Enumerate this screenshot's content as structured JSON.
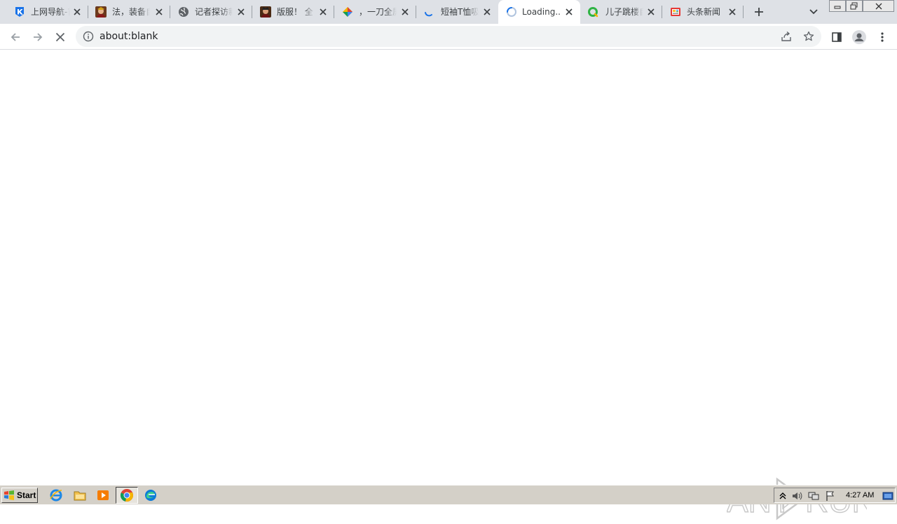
{
  "browser": {
    "tabs": [
      {
        "title": "上网导航-首",
        "icon": "navigation-site-icon",
        "active": false
      },
      {
        "title": "法，装备自",
        "icon": "game-avatar-icon",
        "active": false
      },
      {
        "title": "记者探访新",
        "icon": "globe-icon",
        "active": false
      },
      {
        "title": "版服！ 全",
        "icon": "game-avatar-icon",
        "active": false
      },
      {
        "title": "，一刀全屏",
        "icon": "colorful-diamond-icon",
        "active": false
      },
      {
        "title": "短袖T恤吸",
        "icon": "loading-spinner-icon",
        "active": false
      },
      {
        "title": "Loading...",
        "icon": "loading-spinner-icon",
        "active": true
      },
      {
        "title": "儿子跳楼自",
        "icon": "green-ring-icon",
        "active": false
      },
      {
        "title": "头条新闻",
        "icon": "news-icon",
        "active": false
      }
    ],
    "address_bar": {
      "url": "about:blank"
    },
    "colors": {
      "tab_strip": "#dee1e6",
      "active_tab": "#ffffff",
      "omnibox": "#f1f3f4",
      "taskbar": "#d4d0c8"
    }
  },
  "watermark": {
    "text_left": "ANY",
    "text_right": "RUN"
  },
  "taskbar": {
    "start_label": "Start",
    "clock": "4:27 AM"
  }
}
